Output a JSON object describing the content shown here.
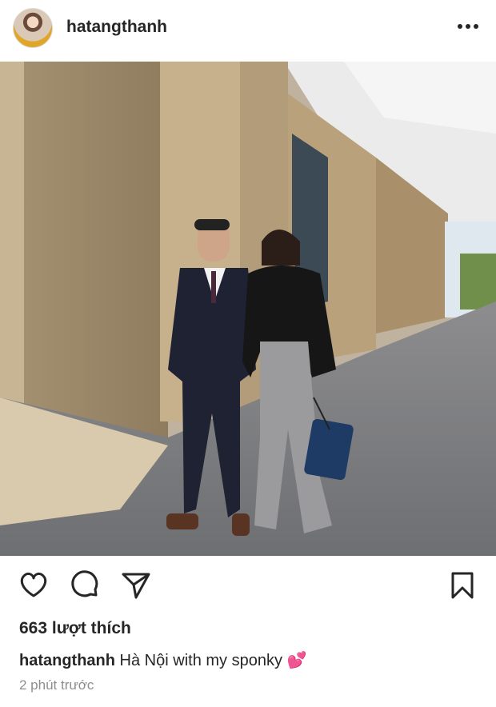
{
  "post": {
    "username": "hatangthanh",
    "likes_text": "663 lượt thích",
    "caption_user": "hatangthanh",
    "caption_text": " Hà Nội with my sponky ",
    "caption_emoji": "💕",
    "timestamp": "2 phút trước"
  },
  "icons": {
    "more": "more-options-icon",
    "like": "heart-icon",
    "comment": "comment-icon",
    "share": "send-icon",
    "save": "bookmark-icon"
  },
  "colors": {
    "text": "#262626",
    "secondary_text": "#8e8e8e",
    "emoji_pink": "#e8508f"
  }
}
